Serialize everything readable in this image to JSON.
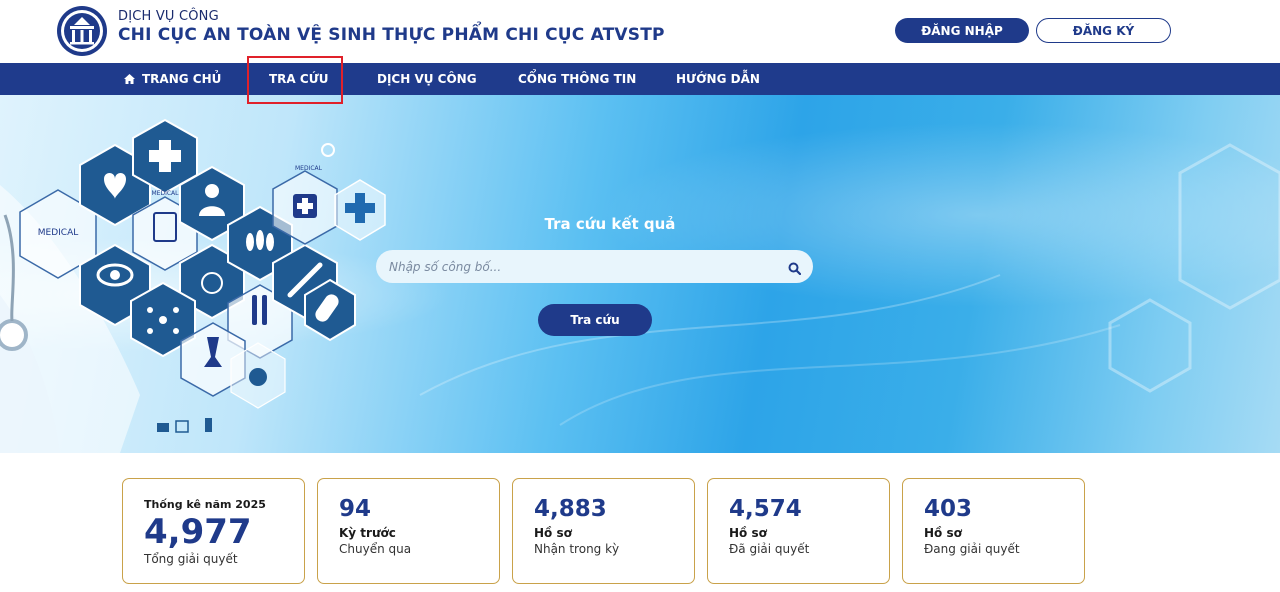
{
  "header": {
    "brand_top": "DỊCH VỤ CÔNG",
    "brand_main": "CHI CỤC AN TOÀN VỆ SINH THỰC PHẨM CHI CỤC ATVSTP",
    "login_label": "ĐĂNG NHẬP",
    "register_label": "ĐĂNG KÝ"
  },
  "nav": {
    "items": [
      {
        "label": "TRANG CHỦ",
        "icon": "home-icon"
      },
      {
        "label": "TRA CỨU"
      },
      {
        "label": "DỊCH VỤ CÔNG"
      },
      {
        "label": "CỔNG THÔNG TIN"
      },
      {
        "label": "HƯỚNG DẪN"
      }
    ]
  },
  "hero": {
    "art_labels": [
      "MEDICAL",
      "MEDICAL",
      "MEDICAL",
      "MEDICAL"
    ],
    "title": "Tra cứu kết quả",
    "search_placeholder": "Nhập số công bố...",
    "search_icon": "search-icon",
    "search_button": "Tra cứu"
  },
  "stats": [
    {
      "heading": "Thống kê năm 2025",
      "value": "4,977",
      "sub": "Tổng giải quyết"
    },
    {
      "value": "94",
      "label": "Kỳ trước",
      "sub": "Chuyển qua"
    },
    {
      "value": "4,883",
      "label": "Hồ sơ",
      "sub": "Nhận trong kỳ"
    },
    {
      "value": "4,574",
      "label": "Hồ sơ",
      "sub": "Đã giải quyết"
    },
    {
      "value": "403",
      "label": "Hồ sơ",
      "sub": "Đang giải quyết"
    }
  ],
  "colors": {
    "brand_blue": "#1f3a8a",
    "nav_blue": "#1f3b8c",
    "card_border": "#c9a24a",
    "highlight": "#e0212a"
  }
}
